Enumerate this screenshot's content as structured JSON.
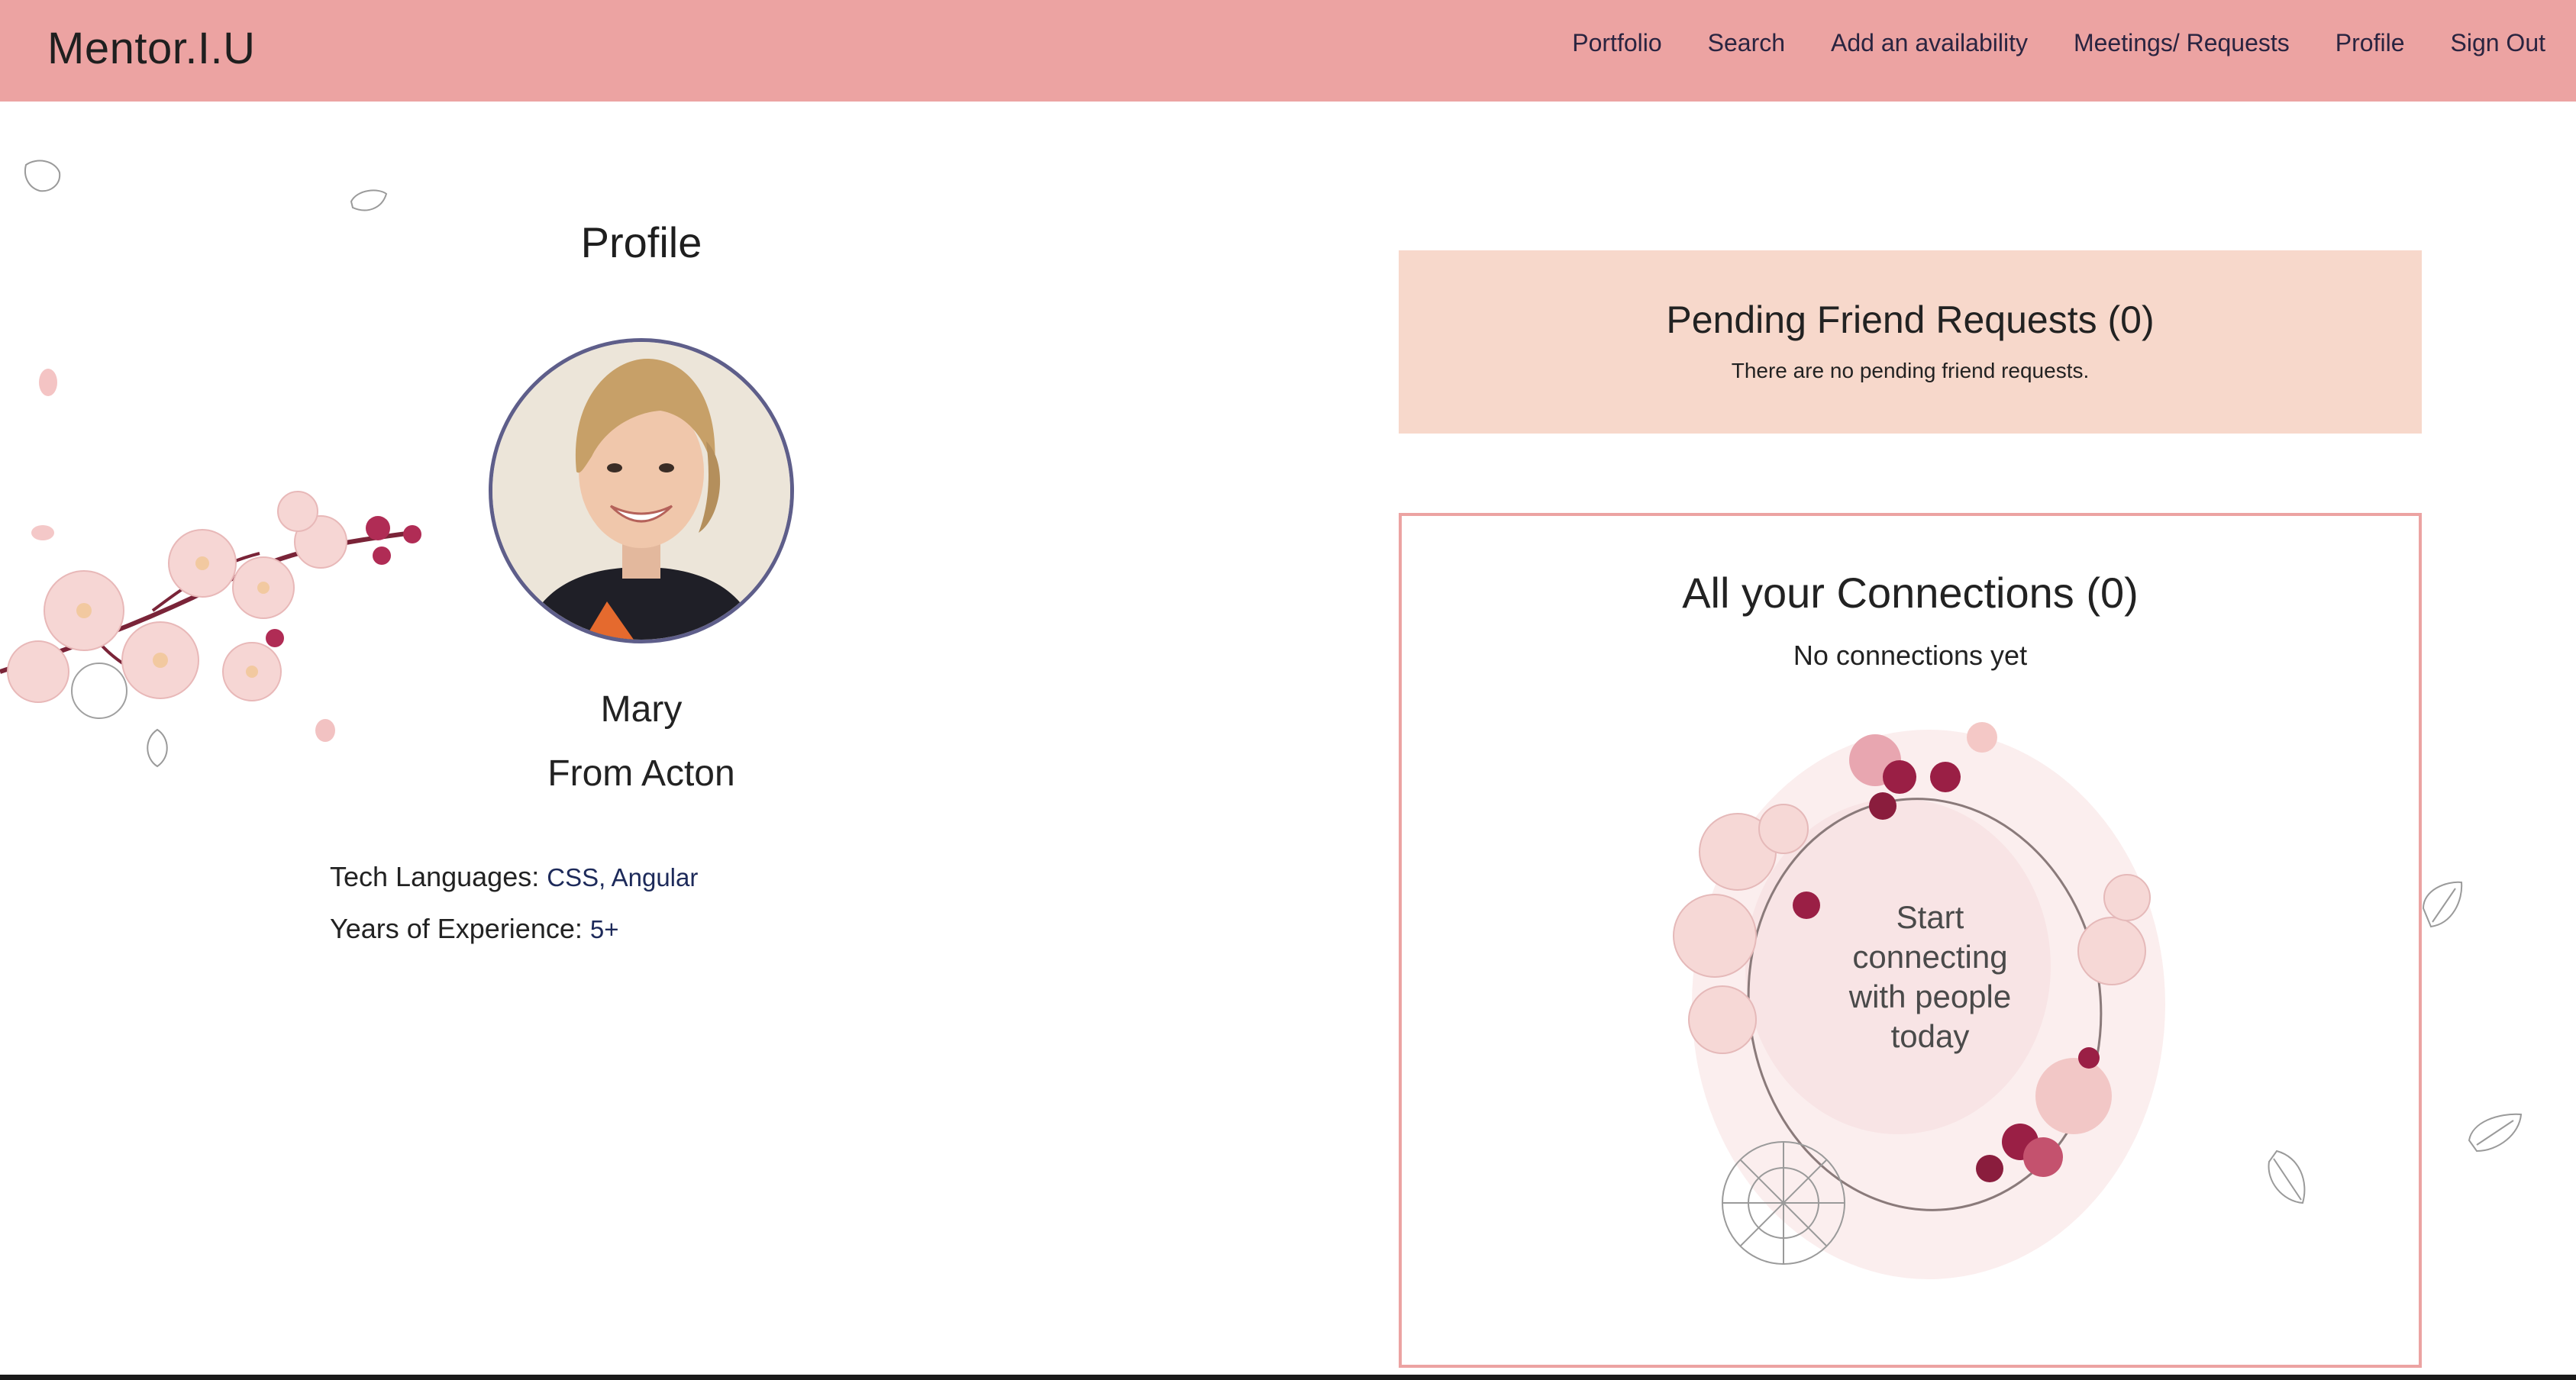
{
  "brand": "Mentor.I.U",
  "nav": {
    "items": [
      {
        "label": "Portfolio"
      },
      {
        "label": "Search"
      },
      {
        "label": "Add an availability"
      },
      {
        "label": "Meetings/ Requests"
      },
      {
        "label": "Profile"
      },
      {
        "label": "Sign Out"
      }
    ]
  },
  "profile": {
    "title": "Profile",
    "name": "Mary",
    "location": "From Acton",
    "tech_label": "Tech Languages:",
    "tech_value": "CSS, Angular",
    "experience_label": "Years of Experience:",
    "experience_value": "5+"
  },
  "pending": {
    "title": "Pending Friend Requests (0)",
    "text": "There are no pending friend requests."
  },
  "connections": {
    "title": "All your Connections (0)",
    "empty": "No connections yet",
    "wreath_lines": [
      "Start",
      "connecting",
      "with people",
      "today"
    ]
  },
  "colors": {
    "navbar": "#eca3a2",
    "pending_bg": "#f7d8cb",
    "connections_border": "#eca3a2",
    "avatar_border": "#5e5e8a"
  }
}
